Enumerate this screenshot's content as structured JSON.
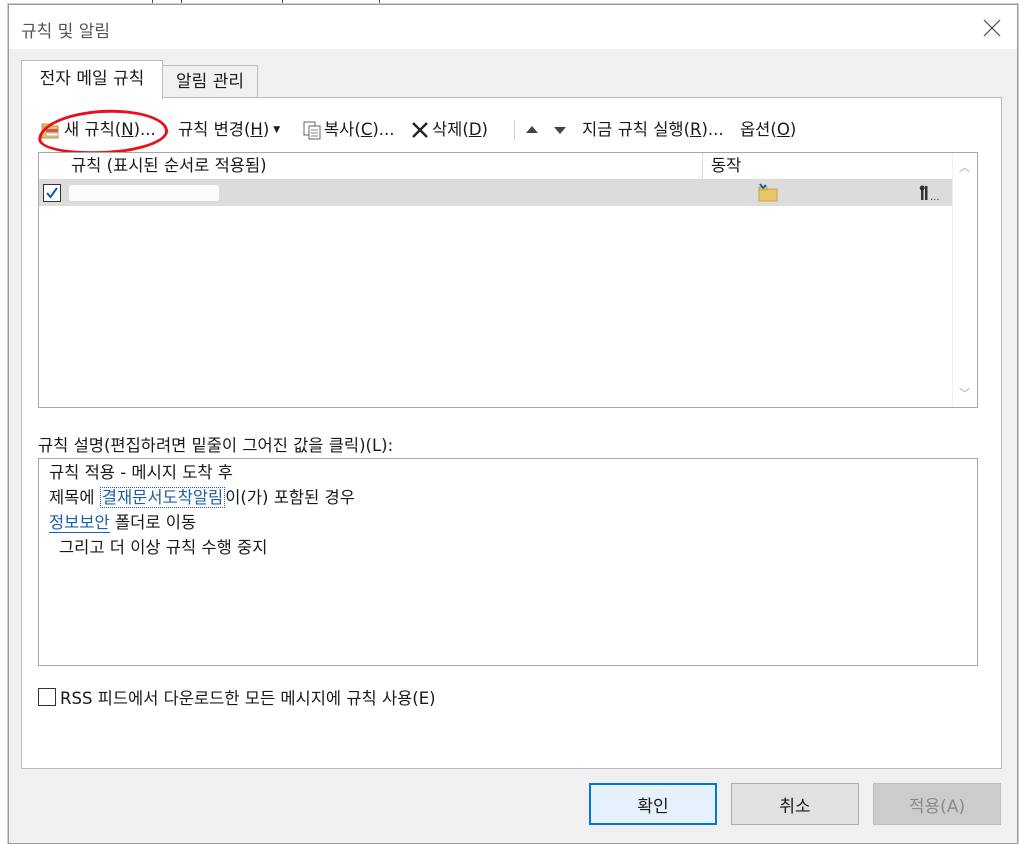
{
  "dialog": {
    "title": "규칙 및 알림",
    "close_icon": "close-icon"
  },
  "tabs": [
    {
      "label": "전자 메일 규칙",
      "active": true
    },
    {
      "label": "알림 관리",
      "active": false
    }
  ],
  "toolbar": {
    "new_rule": {
      "label": "새 규칙(",
      "key": "N",
      "suffix": ")...",
      "icon": "new-rule-icon"
    },
    "change_rule": {
      "label": "규칙 변경(",
      "key": "H",
      "suffix": ")"
    },
    "copy": {
      "label": "복사(",
      "key": "C",
      "suffix": ")...",
      "icon": "copy-icon"
    },
    "delete": {
      "label": "삭제(",
      "key": "D",
      "suffix": ")",
      "icon": "delete-x-icon"
    },
    "run_now": {
      "label": "지금 규칙 실행(",
      "key": "R",
      "suffix": ")..."
    },
    "options": {
      "label": "옵션(",
      "key": "O",
      "suffix": ")"
    }
  },
  "rules_list": {
    "col_rule": "규칙 (표시된 순서로 적용됨)",
    "col_action": "동작",
    "rows": [
      {
        "checked": true,
        "name": "",
        "action_icon": "move-to-folder-icon",
        "more_icon": "rule-settings-icon"
      }
    ]
  },
  "description": {
    "label": "규칙 설명(편집하려면 밑줄이 그어진 값을 클릭)(L):",
    "line1": "규칙 적용 - 메시지 도착 후",
    "line2_prefix": "제목에 ",
    "line2_link": "결재문서도착알림",
    "line2_suffix": "이(가) 포함된 경우",
    "line3_link": "정보보안",
    "line3_suffix": " 폴더로 이동",
    "line4": "그리고 더 이상 규칙 수행 중지"
  },
  "rss": {
    "label": "RSS 피드에서 다운로드한 모든 메시지에 규칙 사용(E)",
    "checked": false
  },
  "buttons": {
    "ok": "확인",
    "cancel": "취소",
    "apply": "적용(A)"
  }
}
